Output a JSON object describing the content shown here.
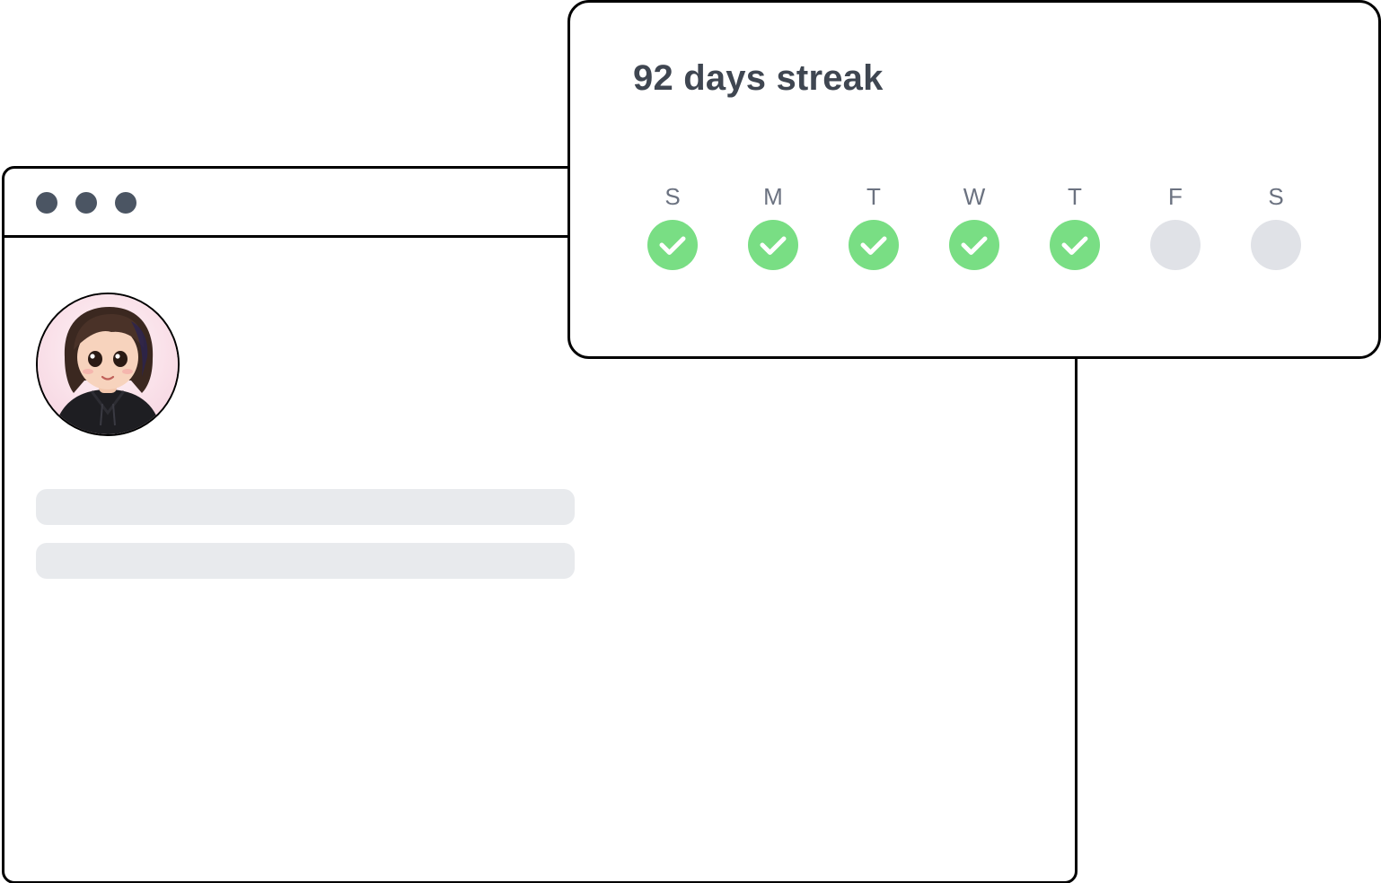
{
  "streak": {
    "title": "92 days streak",
    "days": [
      {
        "label": "S",
        "completed": true
      },
      {
        "label": "M",
        "completed": true
      },
      {
        "label": "T",
        "completed": true
      },
      {
        "label": "W",
        "completed": true
      },
      {
        "label": "T",
        "completed": true
      },
      {
        "label": "F",
        "completed": false
      },
      {
        "label": "S",
        "completed": false
      }
    ]
  },
  "browser": {
    "window_controls": [
      "dot-icon",
      "dot-icon",
      "dot-icon"
    ],
    "skeleton_lines": 2
  },
  "colors": {
    "completed": "#79de84",
    "pending": "#e0e2e7",
    "title_text": "#3f4651",
    "day_label": "#6b7280",
    "skeleton": "#e8eaed",
    "window_dot": "#4b5563"
  },
  "icons": {
    "check": "check-icon",
    "avatar": "user-avatar"
  }
}
